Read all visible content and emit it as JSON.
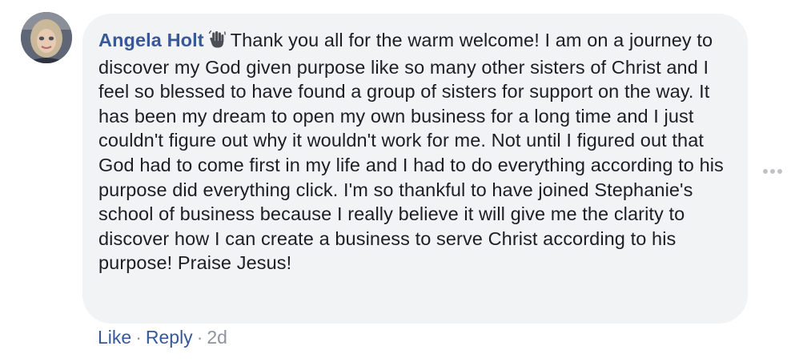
{
  "comment": {
    "author": "Angela Holt",
    "author_badge_icon": "waving-hand-icon",
    "body": "Thank you all for the warm welcome! I am on a journey to discover my God given purpose like so many other sisters of Christ and I feel so blessed to have found a group of sisters for support on the way. It has been my dream to open my own business for a long time and I just couldn't figure out why it wouldn't work for me. Not until I figured out that God had to come first in my life and I had to do everything according to his purpose did everything click. I'm so thankful to have joined Stephanie's school of business because I really believe it will give me the clarity to discover how I can create a business to serve Christ according to his purpose! Praise Jesus!",
    "more_options_icon": "more-options-icon"
  },
  "actions": {
    "like_label": "Like",
    "separator": "·",
    "reply_label": "Reply",
    "timestamp": "2d"
  },
  "colors": {
    "bubble_background": "#f2f3f5",
    "author_link": "#385898",
    "body_text": "#1c1e21",
    "meta_text": "#90949c"
  }
}
